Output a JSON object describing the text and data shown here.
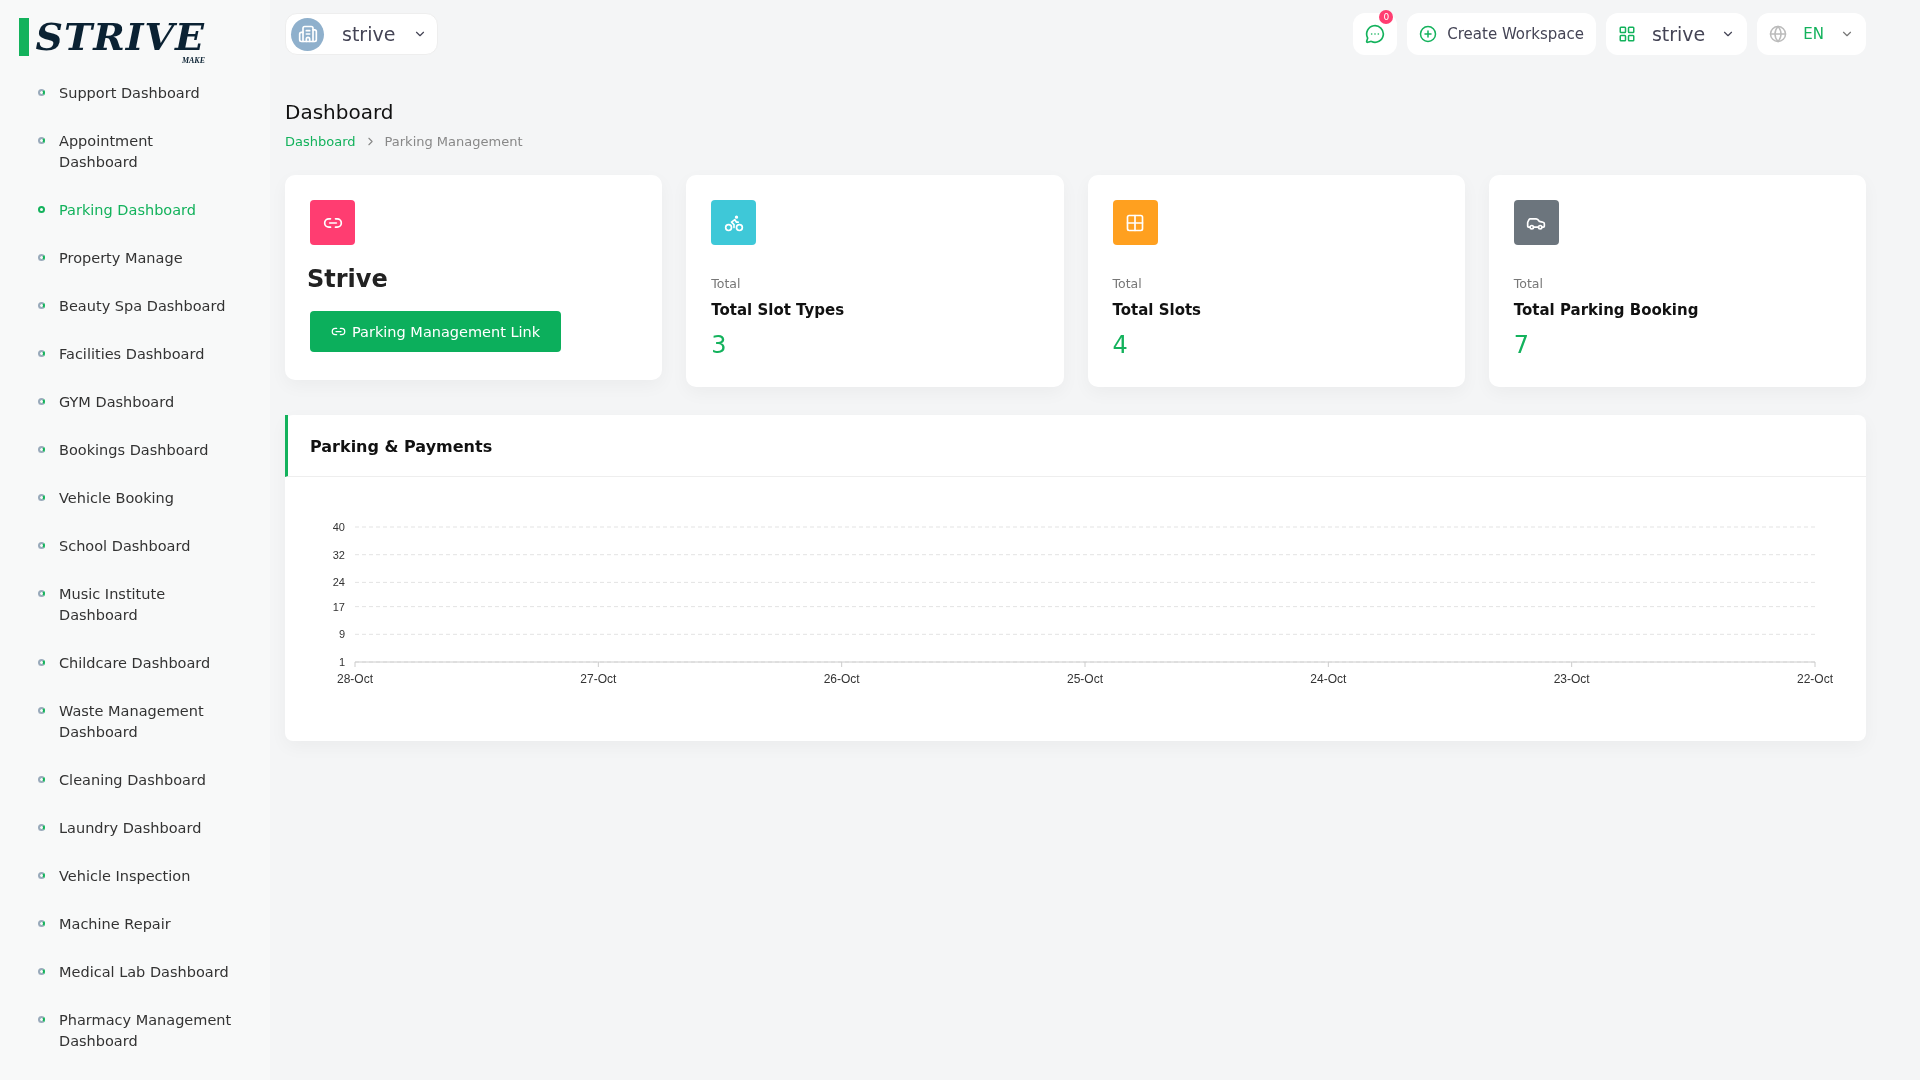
{
  "logo": {
    "text": "STRIVE",
    "sub": "MAKE"
  },
  "sidebar": {
    "items": [
      {
        "label": "Support Dashboard",
        "selected": false
      },
      {
        "label": "Appointment Dashboard",
        "selected": false
      },
      {
        "label": "Parking Dashboard",
        "selected": true
      },
      {
        "label": "Property Manage",
        "selected": false
      },
      {
        "label": "Beauty Spa Dashboard",
        "selected": false
      },
      {
        "label": "Facilities Dashboard",
        "selected": false
      },
      {
        "label": "GYM Dashboard",
        "selected": false
      },
      {
        "label": "Bookings Dashboard",
        "selected": false
      },
      {
        "label": "Vehicle Booking",
        "selected": false
      },
      {
        "label": "School Dashboard",
        "selected": false
      },
      {
        "label": "Music Institute Dashboard",
        "selected": false
      },
      {
        "label": "Childcare Dashboard",
        "selected": false
      },
      {
        "label": "Waste Management Dashboard",
        "selected": false
      },
      {
        "label": "Cleaning Dashboard",
        "selected": false
      },
      {
        "label": "Laundry Dashboard",
        "selected": false
      },
      {
        "label": "Vehicle Inspection",
        "selected": false
      },
      {
        "label": "Machine Repair",
        "selected": false
      },
      {
        "label": "Medical Lab Dashboard",
        "selected": false
      },
      {
        "label": "Pharmacy Management Dashboard",
        "selected": false
      }
    ]
  },
  "topbar": {
    "workspace": "strive",
    "messages_badge": "0",
    "create_button": "Create Workspace",
    "app_switcher": "strive",
    "language": "EN"
  },
  "page": {
    "title": "Dashboard",
    "breadcrumb": [
      {
        "label": "Dashboard",
        "selected": false
      },
      {
        "label": "Parking Management",
        "selected": true
      }
    ]
  },
  "cards": [
    {
      "kind": "link",
      "color": "#ff3d71",
      "title": "Strive",
      "button": "Parking Management Link"
    },
    {
      "kind": "stat",
      "color": "#3ec8d8",
      "caption": "Total",
      "title": "Total Slot Types",
      "value": "3"
    },
    {
      "kind": "stat",
      "color": "#ffa01f",
      "caption": "Total",
      "title": "Total Slots",
      "value": "4"
    },
    {
      "kind": "stat",
      "color": "#6c757d",
      "caption": "Total",
      "title": "Total Parking Booking",
      "value": "7"
    }
  ],
  "chart_panel": {
    "title": "Parking & Payments",
    "chart_data": {
      "type": "line",
      "categories": [
        "28-Oct",
        "27-Oct",
        "26-Oct",
        "25-Oct",
        "24-Oct",
        "23-Oct",
        "22-Oct"
      ],
      "ylim": [
        1,
        40
      ],
      "yticks": [
        1,
        9,
        17,
        24,
        32,
        40
      ],
      "grid": true
    }
  }
}
